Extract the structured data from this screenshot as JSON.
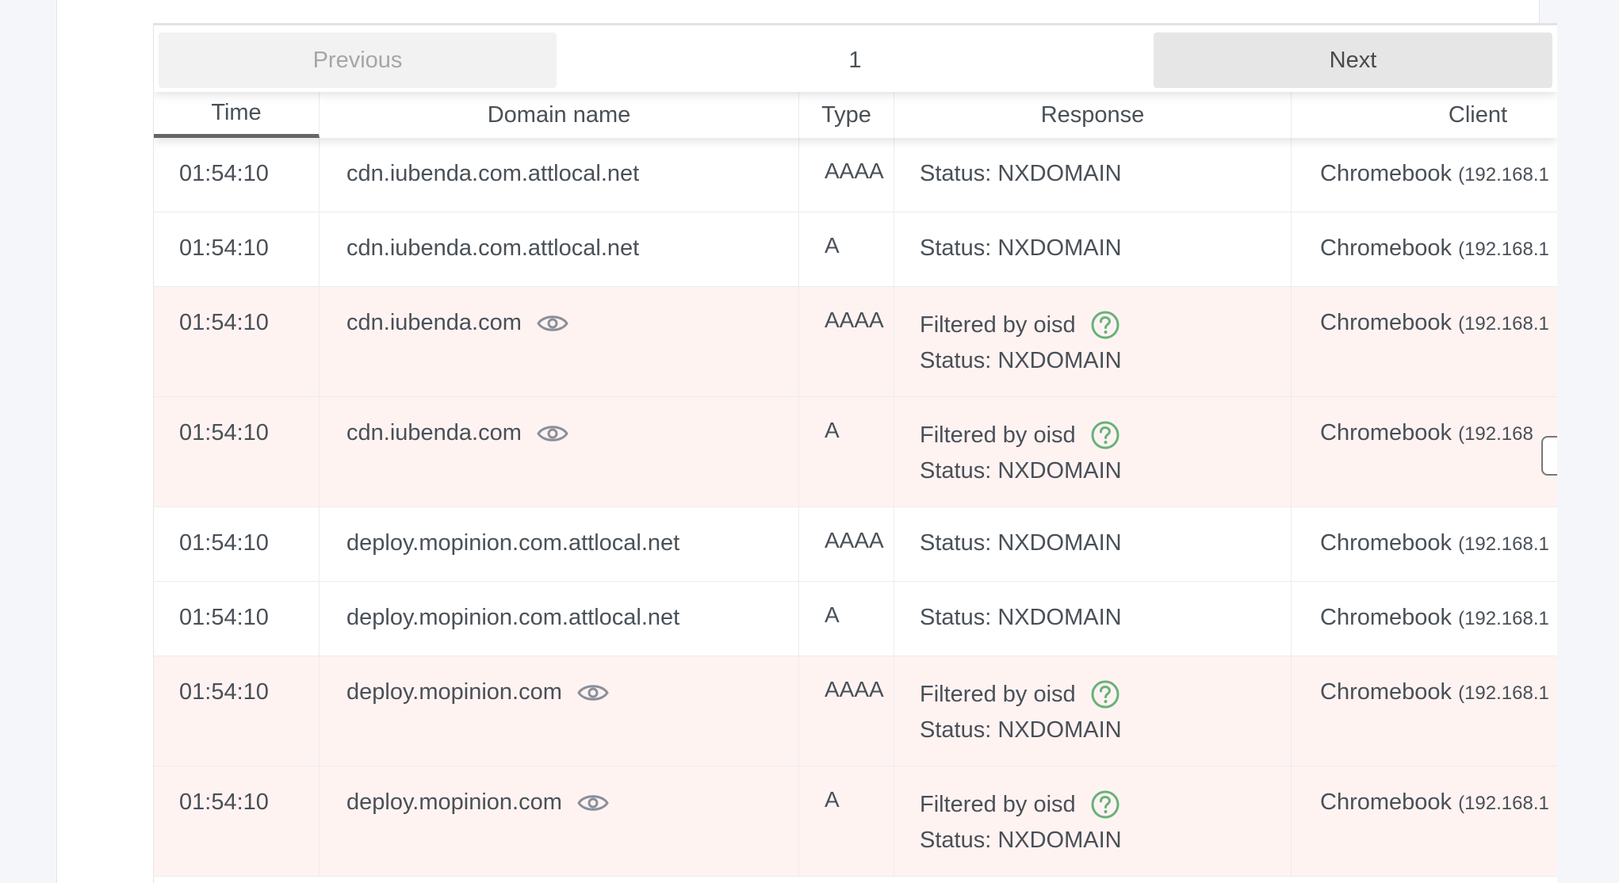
{
  "pagination": {
    "previous_label": "Previous",
    "page_number": "1",
    "next_label": "Next"
  },
  "columns": [
    "Time",
    "Domain name",
    "Type",
    "Response",
    "Client"
  ],
  "rows": [
    {
      "time": "01:54:10",
      "domain": "cdn.iubenda.com.attlocal.net",
      "type": "AAAA",
      "filter": "",
      "status": "Status: NXDOMAIN",
      "client_name": "Chromebook",
      "client_ip": "(192.168.1"
    },
    {
      "time": "01:54:10",
      "domain": "cdn.iubenda.com.attlocal.net",
      "type": "A",
      "filter": "",
      "status": "Status: NXDOMAIN",
      "client_name": "Chromebook",
      "client_ip": "(192.168.1"
    },
    {
      "time": "01:54:10",
      "domain": "cdn.iubenda.com",
      "type": "AAAA",
      "filter": "Filtered by oisd",
      "status": "Status: NXDOMAIN",
      "client_name": "Chromebook",
      "client_ip": "(192.168.1"
    },
    {
      "time": "01:54:10",
      "domain": "cdn.iubenda.com",
      "type": "A",
      "filter": "Filtered by oisd",
      "status": "Status: NXDOMAIN",
      "client_name": "Chromebook",
      "client_ip": "(192.168"
    },
    {
      "time": "01:54:10",
      "domain": "deploy.mopinion.com.attlocal.net",
      "type": "AAAA",
      "filter": "",
      "status": "Status: NXDOMAIN",
      "client_name": "Chromebook",
      "client_ip": "(192.168.1"
    },
    {
      "time": "01:54:10",
      "domain": "deploy.mopinion.com.attlocal.net",
      "type": "A",
      "filter": "",
      "status": "Status: NXDOMAIN",
      "client_name": "Chromebook",
      "client_ip": "(192.168.1"
    },
    {
      "time": "01:54:10",
      "domain": "deploy.mopinion.com",
      "type": "AAAA",
      "filter": "Filtered by oisd",
      "status": "Status: NXDOMAIN",
      "client_name": "Chromebook",
      "client_ip": "(192.168.1"
    },
    {
      "time": "01:54:10",
      "domain": "deploy.mopinion.com",
      "type": "A",
      "filter": "Filtered by oisd",
      "status": "Status: NXDOMAIN",
      "client_name": "Chromebook",
      "client_ip": "(192.168.1"
    }
  ],
  "icons": {
    "domain_action": "eye-icon",
    "filter_help": "question-circle-icon"
  },
  "colors": {
    "filtered_row_bg": "#fff3f2",
    "help_icon": "#67b279",
    "eye_icon": "#8a8f99",
    "sorted_underline": "#666666"
  }
}
